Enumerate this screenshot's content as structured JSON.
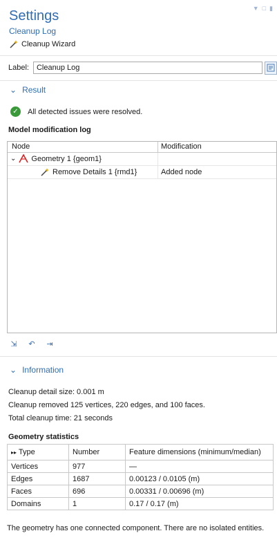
{
  "header": {
    "title": "Settings",
    "subtitle": "Cleanup Log",
    "wizard_label": "Cleanup Wizard"
  },
  "label_field": {
    "label": "Label:",
    "value": "Cleanup Log"
  },
  "result": {
    "section_title": "Result",
    "status_text": "All detected issues were resolved.",
    "log_title": "Model modification log",
    "columns": [
      "Node",
      "Modification"
    ],
    "rows": [
      {
        "node": "Geometry 1 {geom1}",
        "modification": ""
      },
      {
        "node": "Remove Details 1 {rmd1}",
        "modification": "Added node"
      }
    ]
  },
  "information": {
    "section_title": "Information",
    "lines": [
      "Cleanup detail size: 0.001 m",
      "Cleanup removed 125 vertices, 220 edges, and 100 faces.",
      "Total cleanup time: 21 seconds"
    ],
    "stats_title": "Geometry statistics",
    "stats_columns": [
      "Type",
      "Number",
      "Feature dimensions (minimum/median)"
    ],
    "stats_rows": [
      [
        "Vertices",
        "977",
        "—"
      ],
      [
        "Edges",
        "1687",
        "0.00123 / 0.0105 (m)"
      ],
      [
        "Faces",
        "696",
        "0.00331 / 0.00696 (m)"
      ],
      [
        "Domains",
        "1",
        "0.17 / 0.17 (m)"
      ]
    ],
    "footer": "The geometry has one connected component. There are no isolated entities."
  },
  "colors": {
    "accent": "#2f6db5",
    "success": "#3a9a3a"
  }
}
